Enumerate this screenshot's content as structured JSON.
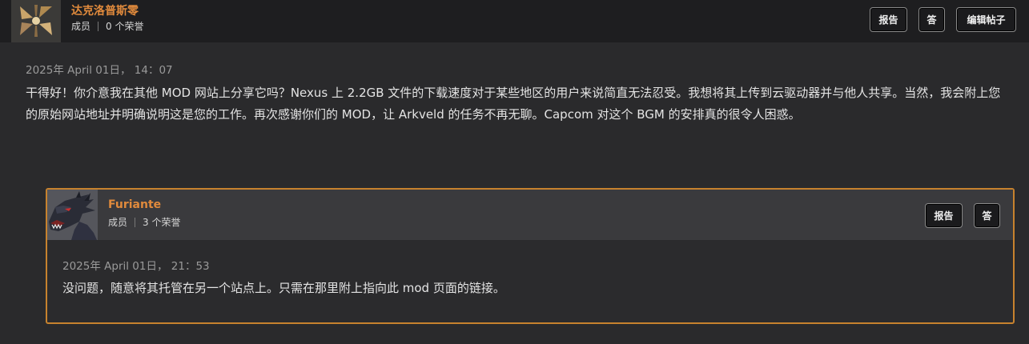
{
  "post": {
    "author": {
      "name": "达克洛普斯零",
      "role": "成员",
      "reputation": "0 个荣誉"
    },
    "buttons": {
      "report": "报告",
      "reply": "答",
      "edit": "编辑帖子"
    },
    "date": "2025年 April 01日， 14：07",
    "body": "干得好！你介意我在其他 MOD 网站上分享它吗？Nexus 上 2.2GB 文件的下载速度对于某些地区的用户来说简直无法忍受。我想将其上传到云驱动器并与他人共享。当然，我会附上您的原始网站地址并明确说明这是您的工作。再次感谢你们的 MOD，让 Arkveld 的任务不再无聊。Capcom 对这个 BGM 的安排真的很令人困惑。"
  },
  "reply": {
    "author": {
      "name": "Furiante",
      "role": "成员",
      "reputation": "3 个荣誉"
    },
    "buttons": {
      "report": "报告",
      "reply": "答"
    },
    "date": "2025年 April 01日， 21：53",
    "body": "没问题，随意将其托管在另一个站点上。只需在那里附上指向此 mod 页面的链接。"
  },
  "colors": {
    "accent": "#e08a3c",
    "reply_border": "#c7822e",
    "background": "#2a2a2c"
  }
}
